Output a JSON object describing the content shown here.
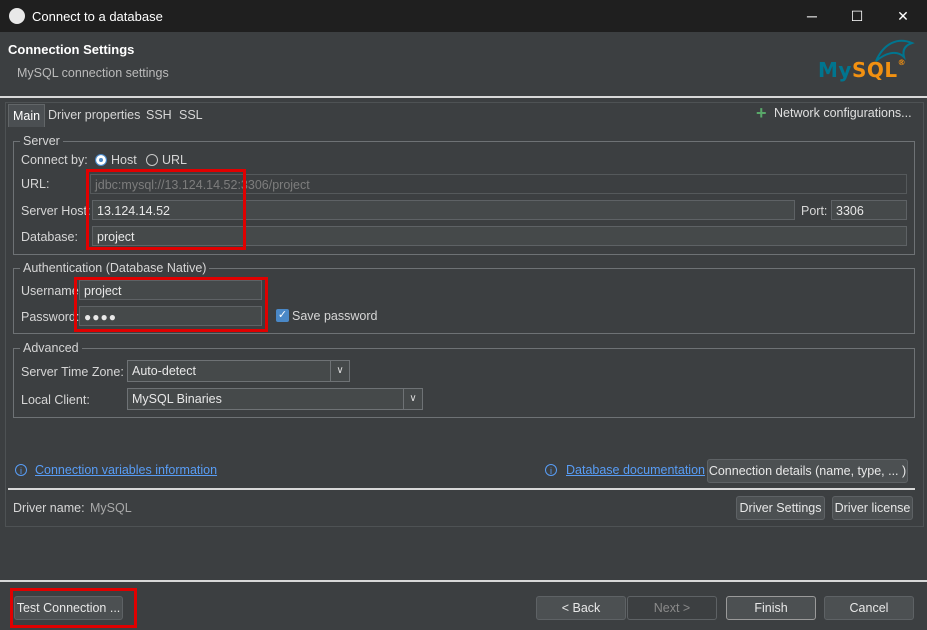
{
  "window": {
    "title": "Connect to a database",
    "controls": {
      "minimize": "─",
      "maximize": "☐",
      "close": "✕"
    }
  },
  "header": {
    "title": "Connection Settings",
    "subtitle": "MySQL connection settings",
    "logo_text": "MySQL",
    "logo_colors": {
      "my": "#00758f",
      "sql": "#f29111"
    }
  },
  "tabs": [
    {
      "label": "Main",
      "active": true
    },
    {
      "label": "Driver properties",
      "active": false
    },
    {
      "label": "SSH",
      "active": false
    },
    {
      "label": "SSL",
      "active": false
    }
  ],
  "network_config": {
    "icon": "plus-icon",
    "label": "Network configurations..."
  },
  "server": {
    "legend": "Server",
    "connect_by_label": "Connect by:",
    "option_host": "Host",
    "option_url": "URL",
    "selected": "Host",
    "url_label": "URL:",
    "url_value": "jdbc:mysql://13.124.14.52:3306/project",
    "host_label": "Server Host:",
    "host_value": "13.124.14.52",
    "port_label": "Port:",
    "port_value": "3306",
    "database_label": "Database:",
    "database_value": "project"
  },
  "auth": {
    "legend": "Authentication (Database Native)",
    "username_label": "Username:",
    "username_value": "project",
    "password_label": "Password:",
    "password_value": "●●●●",
    "save_password_label": "Save password",
    "save_password_checked": true
  },
  "advanced": {
    "legend": "Advanced",
    "timezone_label": "Server Time Zone:",
    "timezone_value": "Auto-detect",
    "client_label": "Local Client:",
    "client_value": "MySQL Binaries"
  },
  "links": {
    "conn_vars": "Connection variables information",
    "db_docs": "Database documentation",
    "conn_details": "Connection details (name, type, ... )"
  },
  "driver": {
    "name_label": "Driver name:",
    "name_value": "MySQL",
    "settings_button": "Driver Settings",
    "license_button": "Driver license"
  },
  "footer": {
    "test_connection": "Test Connection ...",
    "back": "< Back",
    "next": "Next >",
    "finish": "Finish",
    "cancel": "Cancel"
  },
  "colors": {
    "accent": "#4a88c7",
    "link": "#589df6",
    "highlight": "#e00000",
    "plus": "#59a869"
  }
}
